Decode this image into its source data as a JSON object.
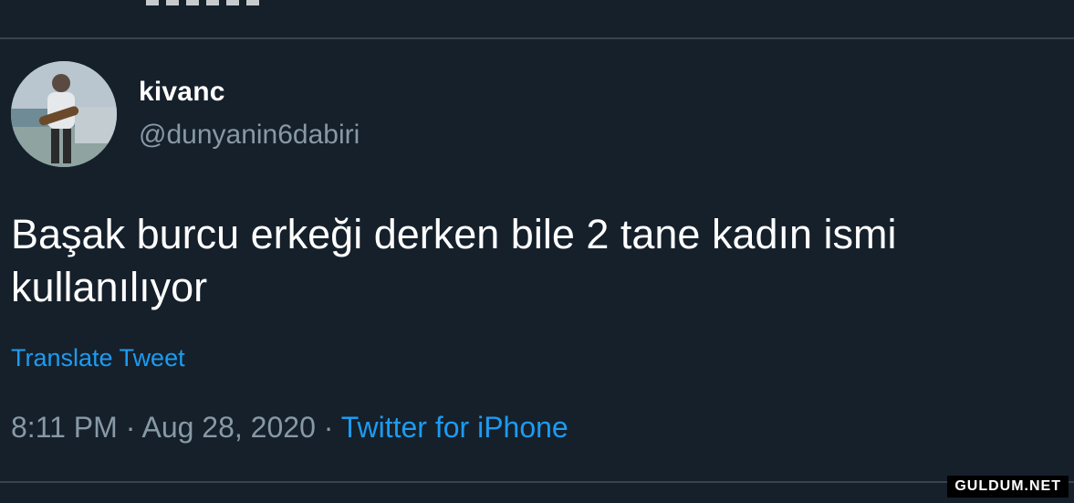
{
  "tweet": {
    "author": {
      "display_name": "kivanc",
      "handle": "@dunyanin6dabiri"
    },
    "text": "Başak burcu erkeği derken bile 2 tane kadın ismi kullanılıyor",
    "translate_label": "Translate Tweet",
    "time": "8:11 PM",
    "date": "Aug 28, 2020",
    "separator": "·",
    "source": "Twitter for iPhone"
  },
  "watermark": "GULDUM.NET",
  "colors": {
    "background": "#15202b",
    "divider": "#38444d",
    "text_primary": "#ffffff",
    "text_secondary": "#8899a6",
    "link": "#1d9bf0"
  }
}
